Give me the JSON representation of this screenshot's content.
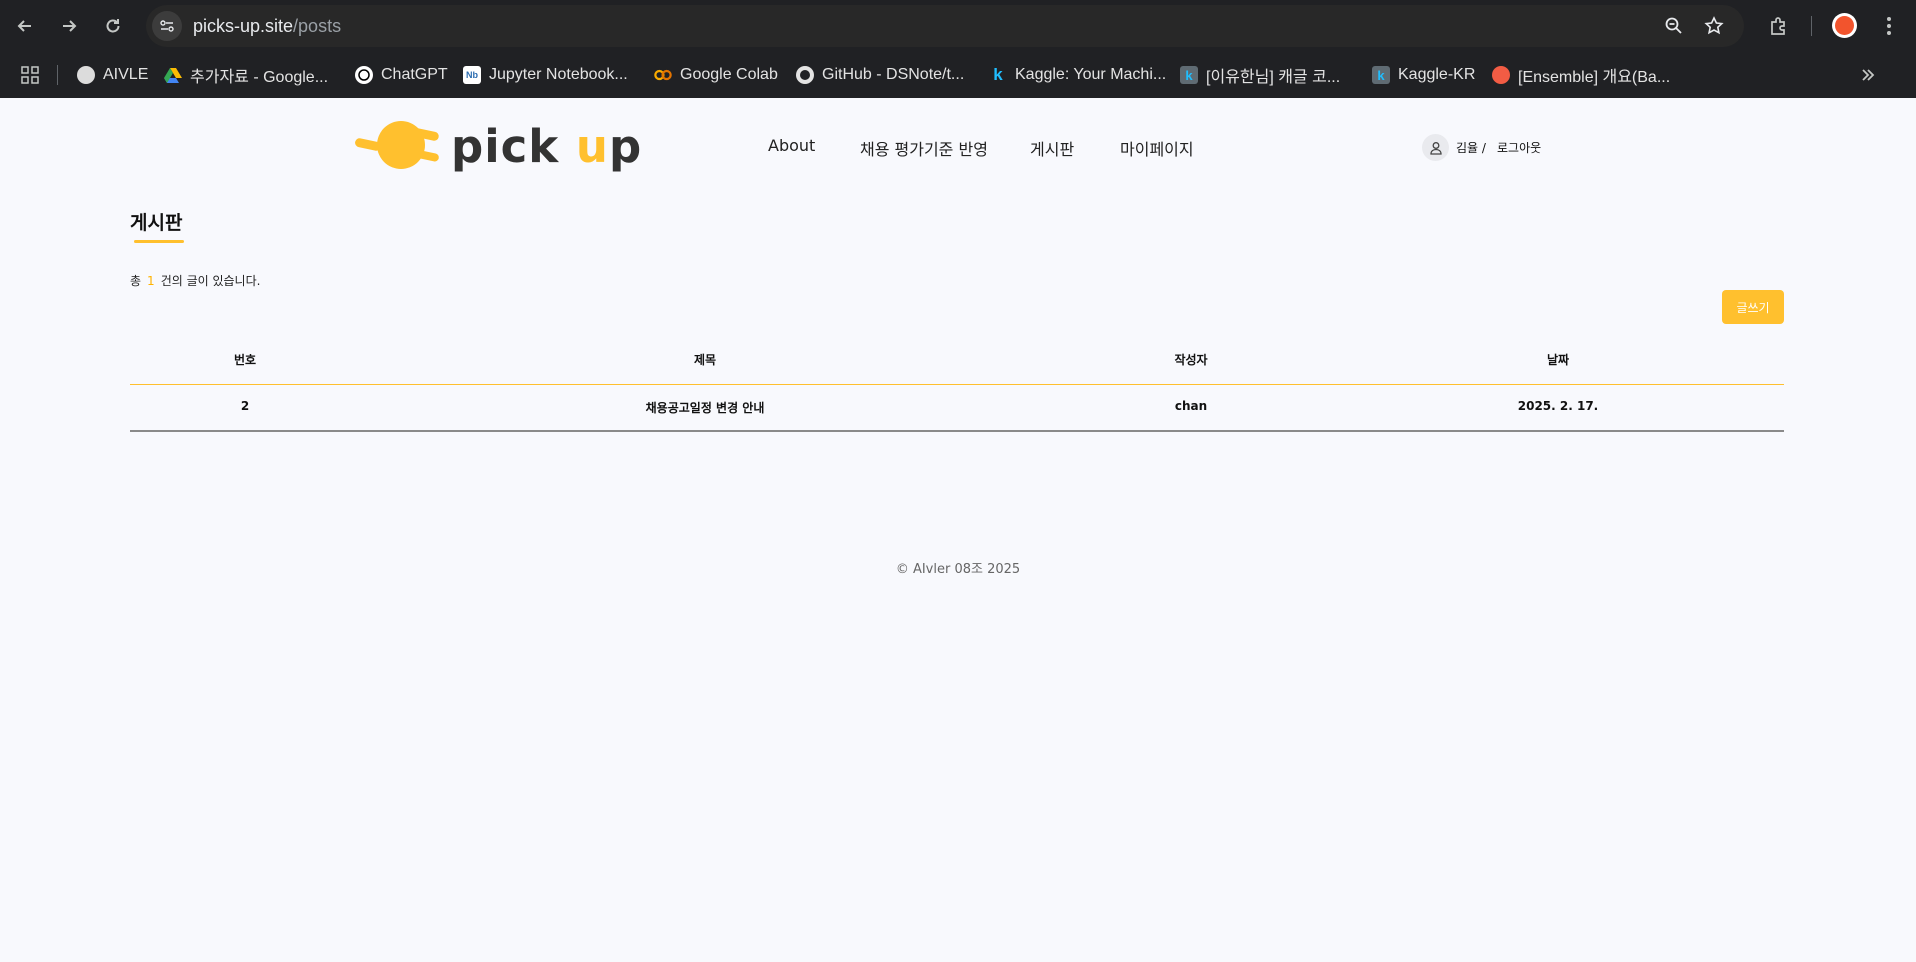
{
  "browser": {
    "url_host": "picks-up.site",
    "url_path": "/posts",
    "bookmarks": [
      {
        "label": "AIVLE",
        "icon": "globe-icon"
      },
      {
        "label": "추가자료 - Google...",
        "icon": "google-drive-icon"
      },
      {
        "label": "ChatGPT",
        "icon": "chatgpt-icon"
      },
      {
        "label": "Jupyter Notebook...",
        "icon": "notebook-icon"
      },
      {
        "label": "Google Colab",
        "icon": "colab-icon"
      },
      {
        "label": "GitHub - DSNote/t...",
        "icon": "github-icon"
      },
      {
        "label": "Kaggle: Your Machi...",
        "icon": "kaggle-icon"
      },
      {
        "label": "[이유한님] 캐글 코...",
        "icon": "kaggle-icon"
      },
      {
        "label": "Kaggle-KR",
        "icon": "kaggle-icon"
      },
      {
        "label": "[Ensemble] 개요(Ba...",
        "icon": "ensemble-icon"
      }
    ]
  },
  "site": {
    "logo_pick": "pick ",
    "logo_u": "u",
    "logo_p": "p",
    "nav": [
      "About",
      "채용 평가기준 반영",
      "게시판",
      "마이페이지"
    ],
    "user_name": "김율 /",
    "logout": "로그아웃"
  },
  "board": {
    "title": "게시판",
    "count_prefix": "총",
    "count": "1",
    "count_suffix": "건의 글이 있습니다.",
    "write_button": "글쓰기",
    "columns": [
      "번호",
      "제목",
      "작성자",
      "날짜"
    ],
    "rows": [
      {
        "no": "2",
        "title": "채용공고일정 변경 안내",
        "author": "chan",
        "date": "2025. 2. 17."
      }
    ]
  },
  "footer": {
    "text": "© AIvler 08조 2025"
  },
  "colors": {
    "accent": "#ffc02e",
    "background": "#f8f9fd",
    "chrome": "#202124"
  }
}
